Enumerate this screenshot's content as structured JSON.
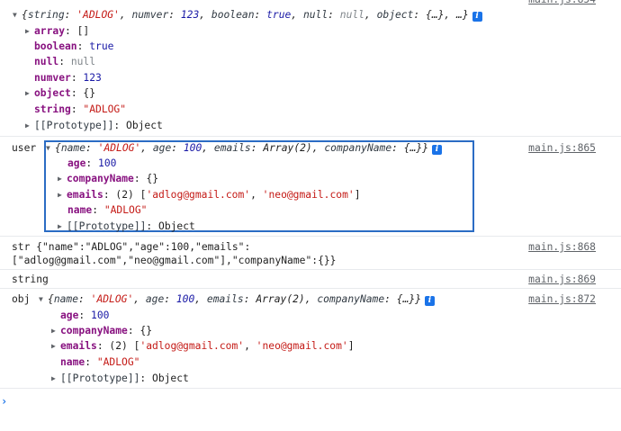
{
  "group1": {
    "header": {
      "open": "{",
      "k1": "string",
      "v1": "'ADLOG'",
      "k2": "numver",
      "v2": "123",
      "k3": "boolean",
      "v3": "true",
      "k4": "null",
      "v4": "null",
      "k5": "object",
      "v5": "{…}",
      "tail": "…}"
    },
    "source": "main.js:854",
    "rows": {
      "array": {
        "key": "array",
        "val": "[]"
      },
      "boolean": {
        "key": "boolean",
        "val": "true"
      },
      "null": {
        "key": "null",
        "val": "null"
      },
      "numver": {
        "key": "numver",
        "val": "123"
      },
      "object": {
        "key": "object",
        "val": "{}"
      },
      "string": {
        "key": "string",
        "val": "\"ADLOG\""
      },
      "proto": {
        "key": "[[Prototype]]",
        "val": "Object"
      }
    }
  },
  "group2": {
    "label": "user",
    "header": {
      "open": "{",
      "k1": "name",
      "v1": "'ADLOG'",
      "k2": "age",
      "v2": "100",
      "k3": "emails",
      "v3": "Array(2)",
      "k4": "companyName",
      "v4": "{…}",
      "close": "}"
    },
    "source": "main.js:865",
    "rows": {
      "age": {
        "key": "age",
        "val": "100"
      },
      "company": {
        "key": "companyName",
        "val": "{}"
      },
      "emails": {
        "key": "emails",
        "count": "(2)",
        "val1": "'adlog@gmail.com'",
        "val2": "'neo@gmail.com'"
      },
      "name": {
        "key": "name",
        "val": "\"ADLOG\""
      },
      "proto": {
        "key": "[[Prototype]]",
        "val": "Object"
      }
    }
  },
  "group3": {
    "line1": "str {\"name\":\"ADLOG\",\"age\":100,\"emails\":",
    "line2": "[\"adlog@gmail.com\",\"neo@gmail.com\"],\"companyName\":{}}",
    "source": "main.js:868"
  },
  "group4": {
    "text": "string",
    "source": "main.js:869"
  },
  "group5": {
    "label": "obj",
    "header": {
      "open": "{",
      "k1": "name",
      "v1": "'ADLOG'",
      "k2": "age",
      "v2": "100",
      "k3": "emails",
      "v3": "Array(2)",
      "k4": "companyName",
      "v4": "{…}",
      "close": "}"
    },
    "source": "main.js:872",
    "rows": {
      "age": {
        "key": "age",
        "val": "100"
      },
      "company": {
        "key": "companyName",
        "val": "{}"
      },
      "emails": {
        "key": "emails",
        "count": "(2)",
        "val1": "'adlog@gmail.com'",
        "val2": "'neo@gmail.com'"
      },
      "name": {
        "key": "name",
        "val": "\"ADLOG\""
      },
      "proto": {
        "key": "[[Prototype]]",
        "val": "Object"
      }
    }
  },
  "icons": {
    "expanded": "▼",
    "collapsed": "▶",
    "info": "i",
    "prompt": "›"
  }
}
